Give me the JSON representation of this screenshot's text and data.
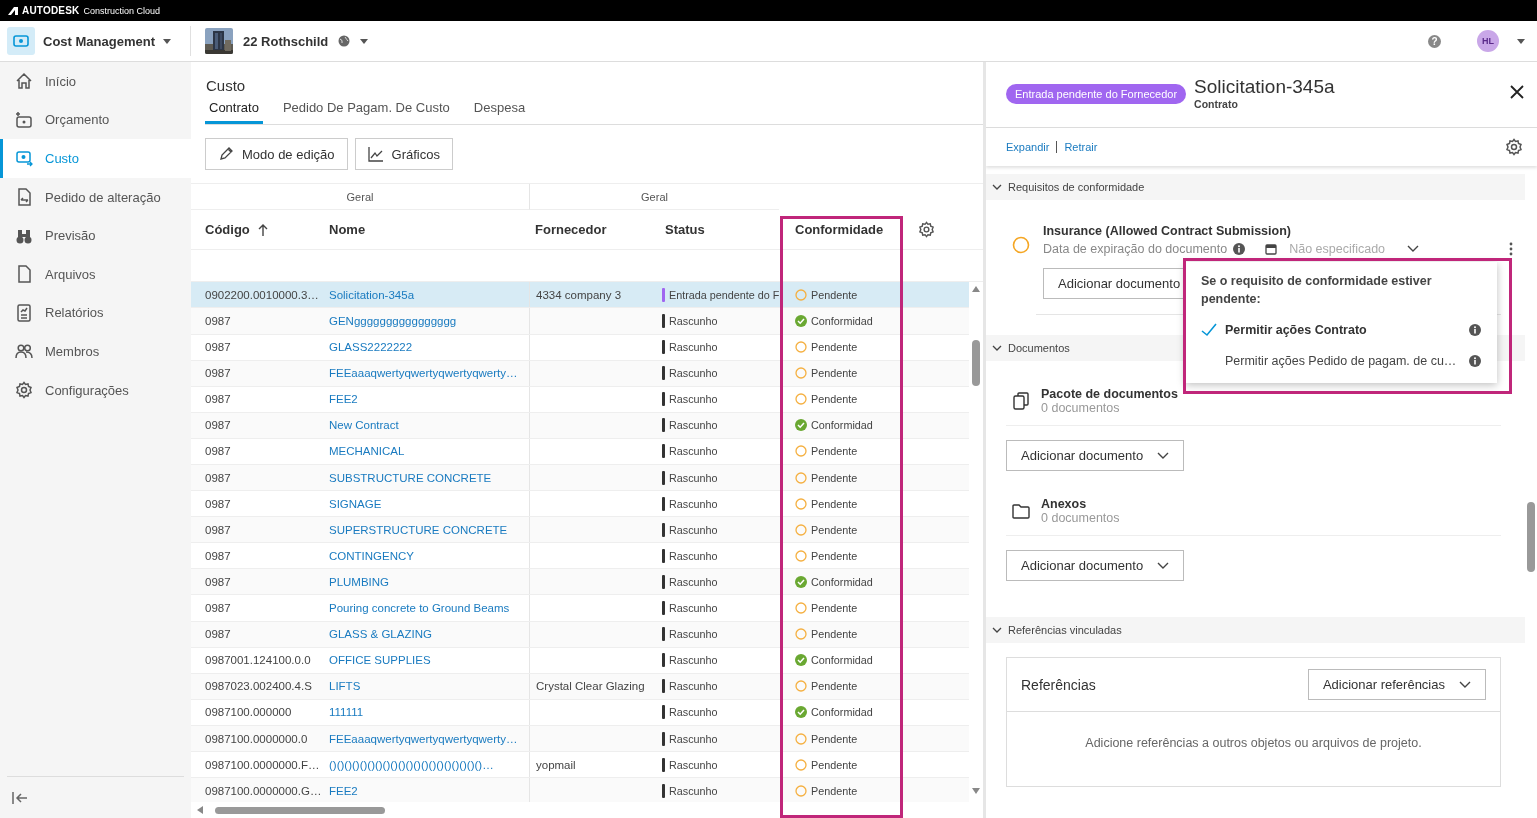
{
  "top_bar": {
    "brand": "AUTODESK",
    "product": "Construction Cloud"
  },
  "header": {
    "module": "Cost Management",
    "project": "22 Rothschild",
    "help": "?",
    "user_initials": "HL"
  },
  "sidebar": {
    "items": [
      {
        "label": "Início",
        "selected": false
      },
      {
        "label": "Orçamento",
        "selected": false
      },
      {
        "label": "Custo",
        "selected": true
      },
      {
        "label": "Pedido de alteração",
        "selected": false
      },
      {
        "label": "Previsão",
        "selected": false
      },
      {
        "label": "Arquivos",
        "selected": false
      },
      {
        "label": "Relatórios",
        "selected": false
      },
      {
        "label": "Membros",
        "selected": false
      },
      {
        "label": "Configurações",
        "selected": false
      }
    ]
  },
  "page": {
    "title": "Custo",
    "tabs": [
      {
        "label": "Contrato",
        "selected": true
      },
      {
        "label": "Pedido De Pagam. De Custo",
        "selected": false
      },
      {
        "label": "Despesa",
        "selected": false
      }
    ],
    "buttons": [
      "Modo de edição",
      "Gráficos"
    ]
  },
  "table": {
    "groups": [
      "Geral",
      "Geral"
    ],
    "highlight_compliance": true,
    "columns": [
      {
        "label": "Código",
        "sorted": true
      },
      {
        "label": "Nome",
        "sorted": false
      },
      {
        "label": "Fornecedor",
        "sorted": false
      },
      {
        "label": "Status",
        "sorted": false
      },
      {
        "label": "Conformidade",
        "sorted": false
      }
    ],
    "rows": [
      {
        "code": "0902200.0010000.3…",
        "name": "Solicitation-345a",
        "supplier": "4334 company 3",
        "status": {
          "label": "Entrada pendente do F",
          "color": "#a066f0"
        },
        "compliance": {
          "label": "Pendente",
          "kind": "pending"
        },
        "selected": true
      },
      {
        "code": "0987",
        "name": "GENgggggggggggggggg",
        "status": {
          "label": "Rascunho",
          "color": "#333333"
        },
        "compliance": {
          "label": "Conformidad",
          "kind": "compliant"
        },
        "selected": false
      },
      {
        "code": "0987",
        "name": "GLASS2222222",
        "status": {
          "label": "Rascunho",
          "color": "#333333"
        },
        "compliance": {
          "label": "Pendente",
          "kind": "pending"
        },
        "selected": false
      },
      {
        "code": "0987",
        "name": "FEEaaaqwertyqwertyqwertyqwerty…",
        "status": {
          "label": "Rascunho",
          "color": "#333333"
        },
        "compliance": {
          "label": "Pendente",
          "kind": "pending"
        },
        "selected": false
      },
      {
        "code": "0987",
        "name": "FEE2",
        "status": {
          "label": "Rascunho",
          "color": "#333333"
        },
        "compliance": {
          "label": "Pendente",
          "kind": "pending"
        },
        "selected": false
      },
      {
        "code": "0987",
        "name": "New Contract",
        "status": {
          "label": "Rascunho",
          "color": "#333333"
        },
        "compliance": {
          "label": "Conformidad",
          "kind": "compliant"
        },
        "selected": false
      },
      {
        "code": "0987",
        "name": "MECHANICAL",
        "status": {
          "label": "Rascunho",
          "color": "#333333"
        },
        "compliance": {
          "label": "Pendente",
          "kind": "pending"
        },
        "selected": false
      },
      {
        "code": "0987",
        "name": "SUBSTRUCTURE CONCRETE",
        "status": {
          "label": "Rascunho",
          "color": "#333333"
        },
        "compliance": {
          "label": "Pendente",
          "kind": "pending"
        },
        "selected": false
      },
      {
        "code": "0987",
        "name": "SIGNAGE",
        "status": {
          "label": "Rascunho",
          "color": "#333333"
        },
        "compliance": {
          "label": "Pendente",
          "kind": "pending"
        },
        "selected": false
      },
      {
        "code": "0987",
        "name": "SUPERSTRUCTURE CONCRETE",
        "status": {
          "label": "Rascunho",
          "color": "#333333"
        },
        "compliance": {
          "label": "Pendente",
          "kind": "pending"
        },
        "selected": false
      },
      {
        "code": "0987",
        "name": "CONTINGENCY",
        "status": {
          "label": "Rascunho",
          "color": "#333333"
        },
        "compliance": {
          "label": "Pendente",
          "kind": "pending"
        },
        "selected": false
      },
      {
        "code": "0987",
        "name": "PLUMBING",
        "status": {
          "label": "Rascunho",
          "color": "#333333"
        },
        "compliance": {
          "label": "Conformidad",
          "kind": "compliant"
        },
        "selected": false
      },
      {
        "code": "0987",
        "name": "Pouring concrete to Ground Beams",
        "status": {
          "label": "Rascunho",
          "color": "#333333"
        },
        "compliance": {
          "label": "Pendente",
          "kind": "pending"
        },
        "selected": false
      },
      {
        "code": "0987",
        "name": "GLASS & GLAZING",
        "status": {
          "label": "Rascunho",
          "color": "#333333"
        },
        "compliance": {
          "label": "Pendente",
          "kind": "pending"
        },
        "selected": false
      },
      {
        "code": "0987001.124100.0.0",
        "name": "OFFICE SUPPLIES",
        "status": {
          "label": "Rascunho",
          "color": "#333333"
        },
        "compliance": {
          "label": "Conformidad",
          "kind": "compliant"
        },
        "selected": false
      },
      {
        "code": "0987023.002400.4.S",
        "name": "LIFTS",
        "supplier": "Crystal Clear Glazing",
        "status": {
          "label": "Rascunho",
          "color": "#333333"
        },
        "compliance": {
          "label": "Pendente",
          "kind": "pending"
        },
        "selected": false
      },
      {
        "code": "0987100.000000",
        "name": "111111",
        "status": {
          "label": "Rascunho",
          "color": "#333333"
        },
        "compliance": {
          "label": "Conformidad",
          "kind": "compliant"
        },
        "selected": false
      },
      {
        "code": "0987100.0000000.0",
        "name": "FEEaaaqwertyqwertyqwertyqwerty…",
        "status": {
          "label": "Rascunho",
          "color": "#333333"
        },
        "compliance": {
          "label": "Pendente",
          "kind": "pending"
        },
        "selected": false
      },
      {
        "code": "0987100.0000000.F…",
        "name": "()()()()()()()()()()()()()()()()()()()()…",
        "supplier": "yopmail",
        "status": {
          "label": "Rascunho",
          "color": "#333333"
        },
        "compliance": {
          "label": "Pendente",
          "kind": "pending"
        },
        "selected": false
      },
      {
        "code": "0987100.0000000.G…",
        "name": "FEE2",
        "status": {
          "label": "Rascunho",
          "color": "#333333"
        },
        "compliance": {
          "label": "Pendente",
          "kind": "pending"
        },
        "selected": false
      }
    ]
  },
  "panel": {
    "badge": "Entrada pendente do Fornecedor",
    "title": "Solicitation-345a",
    "subtitle": "Contrato",
    "links": [
      "Expandir",
      "Retrair"
    ],
    "compliance": {
      "title": "Requisitos de conformidade",
      "expanded": true,
      "requirement": "Insurance (Allowed Contract Submission)",
      "date_label": "Data de expiração do documento",
      "date_placeholder": "Não especificado",
      "button": "Adicionar documento"
    },
    "documents": {
      "title": "Documentos",
      "expanded": true,
      "items": [
        {
          "kind": "package",
          "title": "Pacote de documentos",
          "count": "0 documentos",
          "button": "Adicionar documento"
        },
        {
          "kind": "folder",
          "title": "Anexos",
          "count": "0 documentos",
          "button": "Adicionar documento"
        }
      ]
    },
    "references": {
      "title": "Referências vinculadas",
      "expanded": true,
      "card_title": "Referências",
      "button": "Adicionar referências",
      "empty_text": "Adicione referências a outros objetos ou arquivos de projeto."
    }
  },
  "menu": {
    "highlighted": true,
    "title": "Se o requisito de conformidade estiver pendente:",
    "items": [
      {
        "label": "Permitir ações Contrato",
        "checked": true
      },
      {
        "label": "Permitir ações Pedido de pagam. de cu…",
        "checked": false
      }
    ]
  }
}
